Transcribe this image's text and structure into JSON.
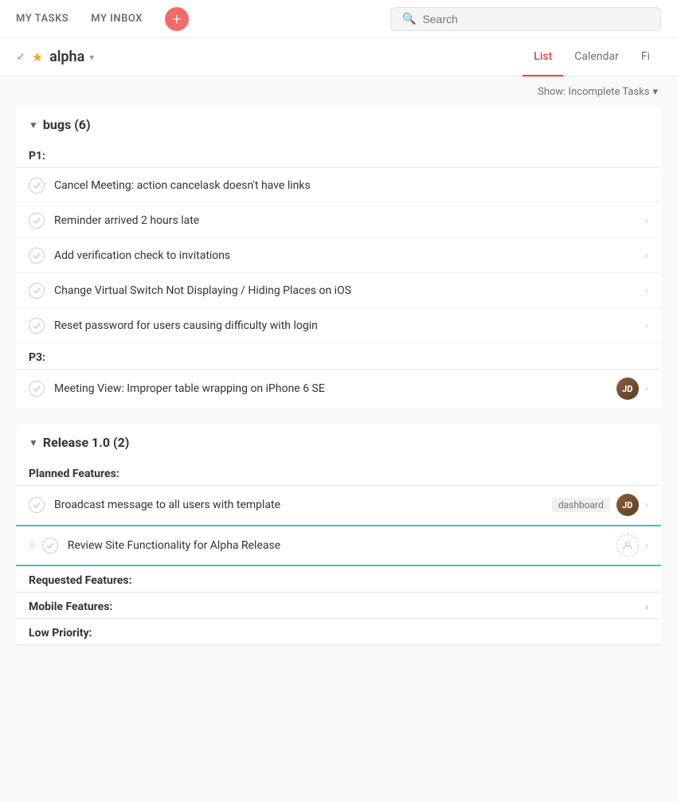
{
  "topNav": {
    "myTasks": "MY TASKS",
    "myInbox": "MY INBOX",
    "addButtonLabel": "+",
    "search": {
      "placeholder": "Search"
    }
  },
  "projectHeader": {
    "projectName": "alpha",
    "caretLabel": "▾",
    "tabs": [
      {
        "id": "list",
        "label": "List",
        "active": true
      },
      {
        "id": "calendar",
        "label": "Calendar",
        "active": false
      },
      {
        "id": "fi",
        "label": "Fi",
        "active": false
      }
    ]
  },
  "filter": {
    "label": "Show: Incomplete Tasks",
    "caret": "▾"
  },
  "sections": [
    {
      "id": "bugs",
      "title": "bugs (6)",
      "subsections": [
        {
          "id": "p1",
          "label": "P1:",
          "tasks": [
            {
              "id": 1,
              "text": "Cancel Meeting: action cancelask doesn't have links",
              "hasAvatar": false,
              "hasTag": false,
              "hasArrow": false
            },
            {
              "id": 2,
              "text": "Reminder arrived 2 hours late",
              "hasAvatar": false,
              "hasTag": false,
              "hasArrow": true
            },
            {
              "id": 3,
              "text": "Add verification check to invitations",
              "hasAvatar": false,
              "hasTag": false,
              "hasArrow": true
            },
            {
              "id": 4,
              "text": "Change Virtual Switch Not Displaying / Hiding Places on iOS",
              "hasAvatar": false,
              "hasTag": false,
              "hasArrow": true
            },
            {
              "id": 5,
              "text": "Reset password for users causing difficulty with login",
              "hasAvatar": false,
              "hasTag": false,
              "hasArrow": true
            }
          ]
        },
        {
          "id": "p3",
          "label": "P3:",
          "tasks": [
            {
              "id": 6,
              "text": "Meeting View: Improper table wrapping on iPhone 6 SE",
              "hasAvatar": true,
              "avatarType": "photo",
              "hasTag": false,
              "hasArrow": true
            }
          ]
        }
      ]
    },
    {
      "id": "release",
      "title": "Release 1.0 (2)",
      "subsections": [
        {
          "id": "planned",
          "label": "Planned Features:",
          "tasks": [
            {
              "id": 7,
              "text": "Broadcast message to all users with template",
              "hasAvatar": true,
              "avatarType": "photo",
              "hasTag": true,
              "tag": "dashboard",
              "hasArrow": true
            },
            {
              "id": 8,
              "text": "Review Site Functionality for Alpha Release",
              "hasAvatar": true,
              "avatarType": "outline",
              "hasTag": false,
              "hasArrow": true,
              "highlighted": true,
              "hasDragHandle": true
            }
          ]
        },
        {
          "id": "requested",
          "label": "Requested Features:",
          "tasks": []
        },
        {
          "id": "mobile",
          "label": "Mobile Features:",
          "tasks": [],
          "hasArrow": true
        },
        {
          "id": "lowpriority",
          "label": "Low Priority:",
          "tasks": []
        }
      ]
    }
  ]
}
